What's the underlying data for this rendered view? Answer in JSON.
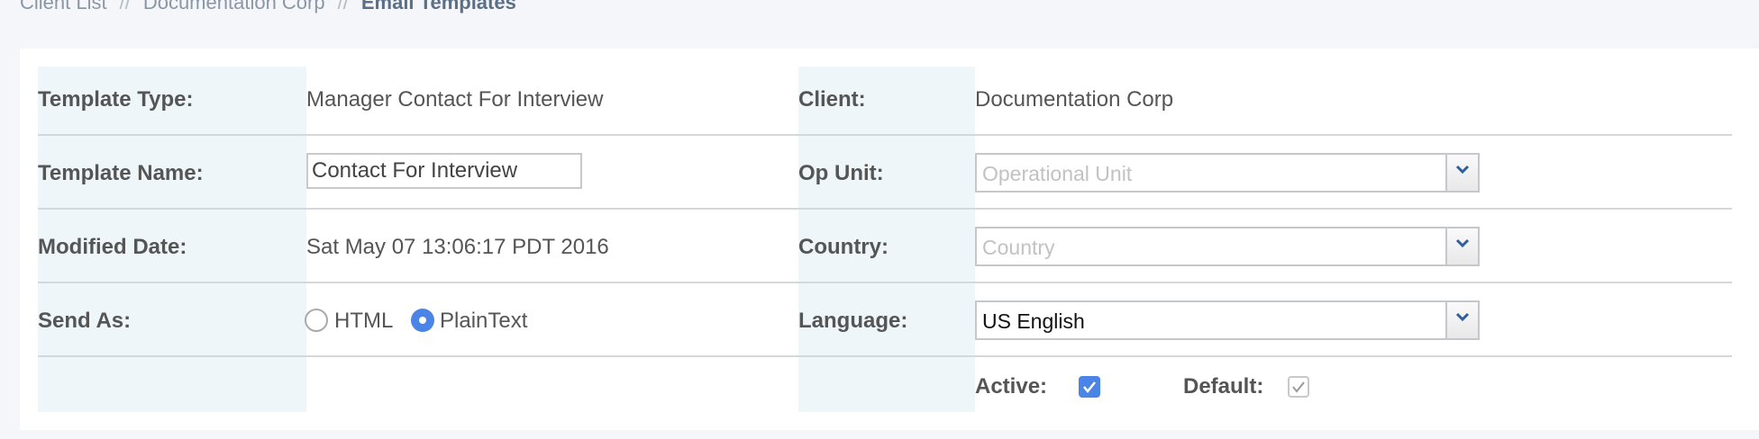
{
  "breadcrumb": {
    "items": [
      "Client List",
      "Documentation Corp",
      "Email Templates"
    ],
    "separator": "//"
  },
  "form": {
    "template_type": {
      "label": "Template Type:",
      "value": "Manager Contact For Interview"
    },
    "template_name": {
      "label": "Template Name:",
      "value": "Contact For Interview"
    },
    "modified_date": {
      "label": "Modified Date:",
      "value": "Sat May 07 13:06:17 PDT 2016"
    },
    "send_as": {
      "label": "Send As:",
      "options": [
        "HTML",
        "PlainText"
      ],
      "selected": "PlainText"
    },
    "client": {
      "label": "Client:",
      "value": "Documentation Corp"
    },
    "op_unit": {
      "label": "Op Unit:",
      "placeholder": "Operational Unit",
      "value": ""
    },
    "country": {
      "label": "Country:",
      "placeholder": "Country",
      "value": ""
    },
    "language": {
      "label": "Language:",
      "value": "US English"
    },
    "active": {
      "label": "Active:",
      "checked": true
    },
    "default": {
      "label": "Default:",
      "checked": true,
      "disabled": true
    }
  },
  "colors": {
    "accent": "#4a84e6",
    "label_column_bg": "#eef6fa",
    "page_bg": "#f4f6f9"
  }
}
